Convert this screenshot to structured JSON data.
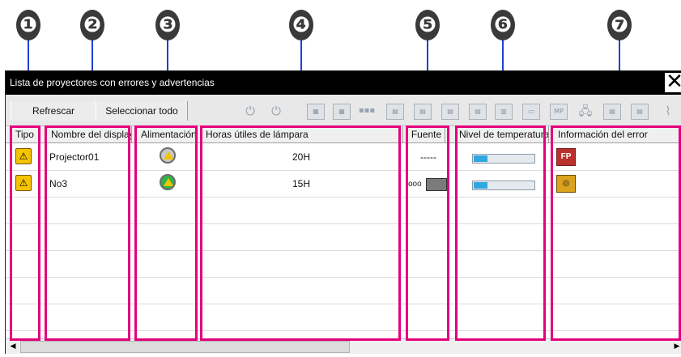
{
  "callouts": [
    "❶",
    "❷",
    "❸",
    "❹",
    "❺",
    "❻",
    "❼"
  ],
  "window": {
    "title": "Lista de proyectores con errores y advertencias",
    "close_glyph": "✕"
  },
  "toolbar": {
    "refresh_label": "Refrescar",
    "select_all_label": "Seleccionar todo",
    "icons": [
      "power-on-icon",
      "power-off-icon",
      "source-icon-1",
      "source-icon-2",
      "source-icon-3",
      "source-icon-4",
      "source-icon-5",
      "source-icon-6",
      "source-icon-7",
      "source-icon-8",
      "source-icon-9",
      "mp-icon",
      "network-icon",
      "source-icon-10",
      "source-icon-11",
      "wireless-icon"
    ]
  },
  "columns": [
    "Tipo",
    "Nombre del display",
    "Alimentación",
    "Horas útiles de lámpara",
    "Fuente",
    "Nivel de temperatura",
    "Información del error"
  ],
  "rows": [
    {
      "type": "warning",
      "name": "Projector01",
      "power": "warning",
      "lamp_hours": "20H",
      "source": "-----",
      "temperature_level": 0.22,
      "error": "FP"
    },
    {
      "type": "warning",
      "name": "No3",
      "power": "on-warning",
      "lamp_hours": "15H",
      "source": "video-icon",
      "temperature_level": 0.22,
      "error": "filter"
    }
  ],
  "colors": {
    "highlight": "#e4007c",
    "pointer": "#1f3fd6",
    "titlebar": "#000000",
    "temperature_fill": "#31a7df"
  }
}
